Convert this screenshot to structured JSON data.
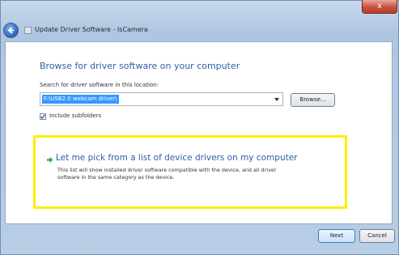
{
  "window": {
    "background_title": "",
    "close_symbol": "x",
    "title": "Update Driver Software - IsCamera"
  },
  "browse": {
    "heading": "Browse for driver software on your computer",
    "search_label": "Search for driver software in this location:",
    "path_value": "F:\\USB2.0 webcam driver\\",
    "browse_button": "Browse...",
    "include_subfolders": "Include subfolders",
    "include_subfolders_checked": true
  },
  "pick_option": {
    "title": "Let me pick from a list of device drivers on my computer",
    "description_line1": "This list will show installed driver software compatible with the device, and all driver",
    "description_line2": "software in the same category as the device."
  },
  "footer": {
    "next_button": "Next",
    "cancel_button": "Cancel"
  },
  "colors": {
    "heading": "#2d5fa8",
    "highlight_border": "#ffee00",
    "selection": "#3399ff"
  },
  "icons": {
    "back": "back-arrow-icon",
    "pick_arrow": "green-arrow-icon"
  }
}
